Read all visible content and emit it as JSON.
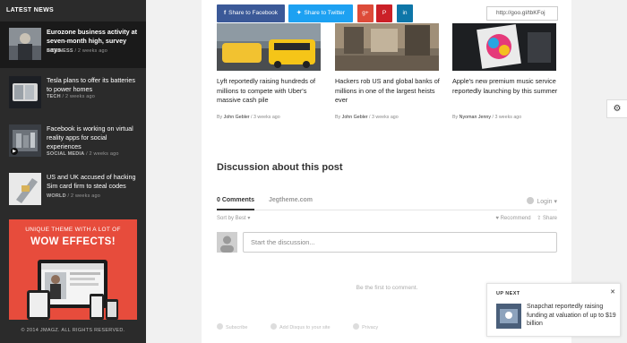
{
  "sidebar": {
    "heading": "LATEST NEWS",
    "items": [
      {
        "title": "Eurozone business activity at seven-month high, survey says",
        "category": "BUSINESS",
        "time": "2 weeks ago"
      },
      {
        "title": "Tesla plans to offer its batteries to power homes",
        "category": "TECH",
        "time": "2 weeks ago"
      },
      {
        "title": "Facebook is working on virtual reality apps for social experiences",
        "category": "SOCIAL MEDIA",
        "time": "2 weeks ago"
      },
      {
        "title": "US and UK accused of hacking Sim card firm to steal codes",
        "category": "WORLD",
        "time": "2 weeks ago"
      }
    ],
    "ad": {
      "line1": "UNIQUE THEME WITH A LOT OF",
      "line2": "WOW EFFECTS!"
    },
    "footer": "© 2014 JMAGZ. ALL RIGHTS RESERVED."
  },
  "share": {
    "facebook": "Share to Facebook",
    "twitter": "Share to Twitter",
    "url": "http://goo.gl/tbKFoj"
  },
  "cards": [
    {
      "title": "Lyft reportedly raising hundreds of millions to compete with Uber's massive cash pile",
      "by": "By",
      "author": "John Gebler",
      "time": "3 weeks ago"
    },
    {
      "title": "Hackers rob US and global banks of millions in one of the largest heists ever",
      "by": "By",
      "author": "John Gebler",
      "time": "3 weeks ago"
    },
    {
      "title": "Apple's new premium music service reportedly launching by this summer",
      "by": "By",
      "author": "Nyoman Jenny",
      "time": "3 weeks ago"
    }
  ],
  "discussion": {
    "title": "Discussion about this post",
    "tab_comments": "0 Comments",
    "tab_site": "Jegtheme.com",
    "login": "Login",
    "sort": "Sort by Best",
    "recommend": "Recommend",
    "share": "Share",
    "placeholder": "Start the discussion...",
    "first": "Be the first to comment.",
    "subscribe": "Subscribe",
    "add_disqus": "Add Disqus to your site",
    "privacy": "Privacy"
  },
  "upnext": {
    "label": "UP NEXT",
    "title": "Snapchat reportedly raising funding at valuation of up to $19 billion"
  },
  "icons": [
    "play-icon",
    "gear-icon",
    "close-icon",
    "user-avatar-icon",
    "heart-icon",
    "share-icon",
    "chevron-down-icon"
  ]
}
